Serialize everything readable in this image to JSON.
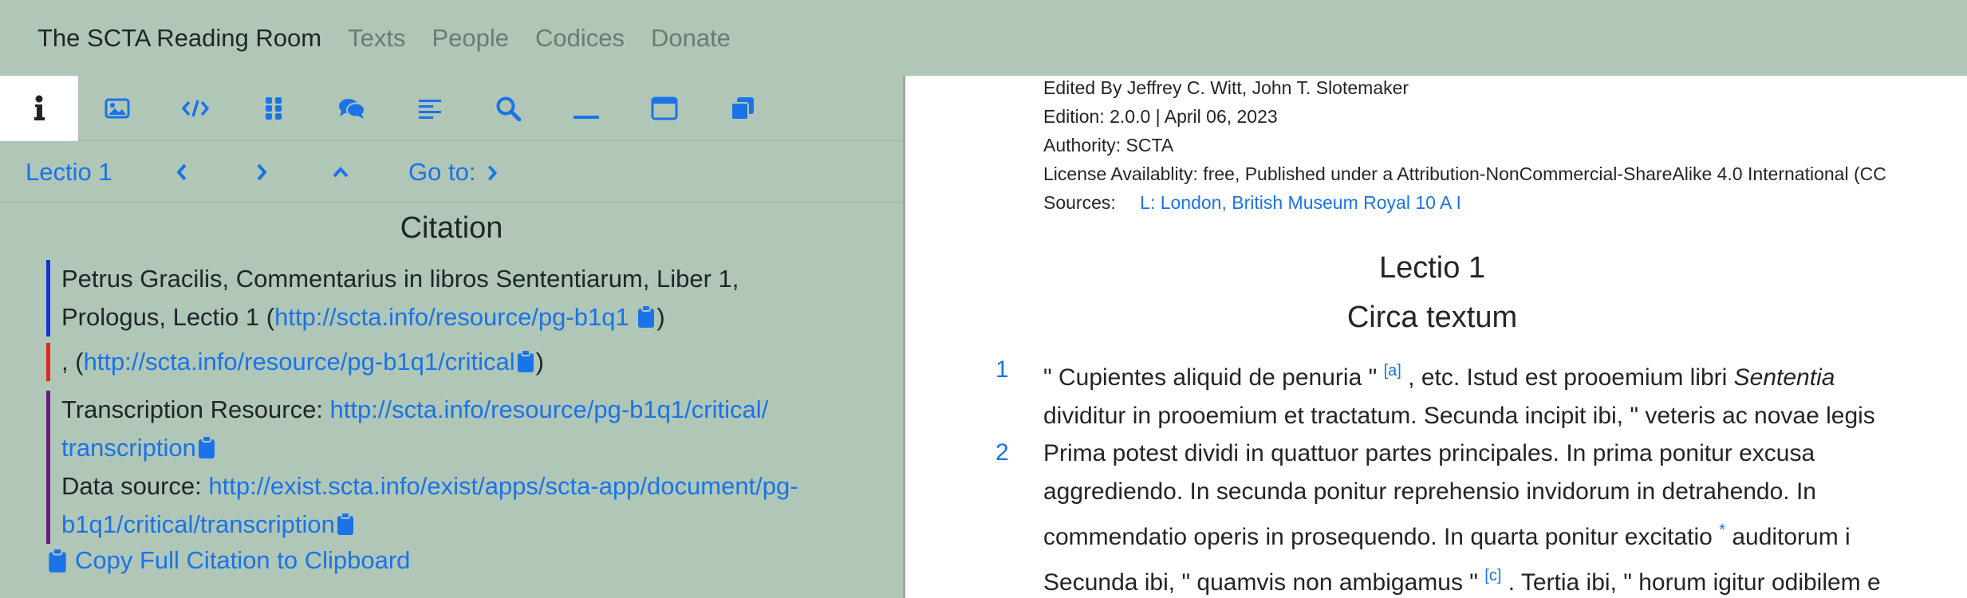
{
  "navbar": {
    "brand": "The SCTA Reading Room",
    "links": [
      "Texts",
      "People",
      "Codices",
      "Donate"
    ]
  },
  "tabs": [
    {
      "icon": "info-icon"
    },
    {
      "icon": "image-icon"
    },
    {
      "icon": "code-icon"
    },
    {
      "icon": "grid-icon"
    },
    {
      "icon": "comments-icon"
    },
    {
      "icon": "align-left-icon"
    },
    {
      "icon": "search-icon"
    },
    {
      "icon": "minimize-icon"
    },
    {
      "icon": "window-icon"
    },
    {
      "icon": "clone-icon"
    }
  ],
  "nav": {
    "current": "Lectio 1",
    "goto": "Go to:"
  },
  "citation": {
    "title": "Citation",
    "main_text_1": "Petrus Gracilis, Commentarius in libros Sententiarum, Liber 1,",
    "main_text_2": "Prologus, Lectio 1 (",
    "main_link": "http://scta.info/resource/pg-b1q1",
    "close_paren": ")",
    "critical_prefix": ", (",
    "critical_link": "http://scta.info/resource/pg-b1q1/critical",
    "transcription_label": "Transcription Resource: ",
    "transcription_link_1": "http://scta.info/resource/pg-b1q1/critical/",
    "transcription_link_2": "transcription",
    "data_source_label": "Data source: ",
    "data_source_link_1": "http://exist.scta.info/exist/apps/scta-app/document/pg-",
    "data_source_link_2": "b1q1/critical/transcription",
    "copy_full": "Copy Full Citation to Clipboard"
  },
  "edition": {
    "edited_by": "Edited By Jeffrey C. Witt, John T. Slotemaker",
    "edition": "Edition: 2.0.0 | April 06, 2023",
    "authority": "Authority: SCTA",
    "license": "License Availablity: free, Published under a Attribution-NonCommercial-ShareAlike 4.0 International (CC",
    "sources_label": "Sources:",
    "sources_link": "L: London, British Museum Royal 10 A I"
  },
  "text": {
    "heading": "Lectio 1",
    "subheading": "Circa textum",
    "p1_num": "1",
    "p1_l1_a": "\" Cupientes aliquid de penuria \" ",
    "p1_l1_sup": "[a]",
    "p1_l1_b": " , etc. Istud est prooemium libri ",
    "p1_l1_italic": "Sententia",
    "p1_l2": "dividitur in prooemium et tractatum. Secunda incipit ibi, \" veteris ac novae legis",
    "p2_num": "2",
    "p2_l1": "Prima potest dividi in quattuor partes principales. In prima ponitur excusa",
    "p2_l2": "aggrediendo. In secunda ponitur reprehensio invidorum in detrahendo. In",
    "p2_l3_a": "commendatio operis in prosequendo. In quarta ponitur excitatio ",
    "p2_l3_sup": "*",
    "p2_l3_b": " auditorum i",
    "p2_l4_a": "Secunda ibi, \" quamvis non ambigamus \" ",
    "p2_l4_sup": "[c]",
    "p2_l4_b": " . Tertia ibi, \" horum igitur odibilem e"
  },
  "colors": {
    "panel_bg": "#b0c7b7",
    "link": "#1a73e8",
    "bar_blue": "#1530d6",
    "bar_red": "#e0261c",
    "bar_purple": "#6b1a80"
  }
}
